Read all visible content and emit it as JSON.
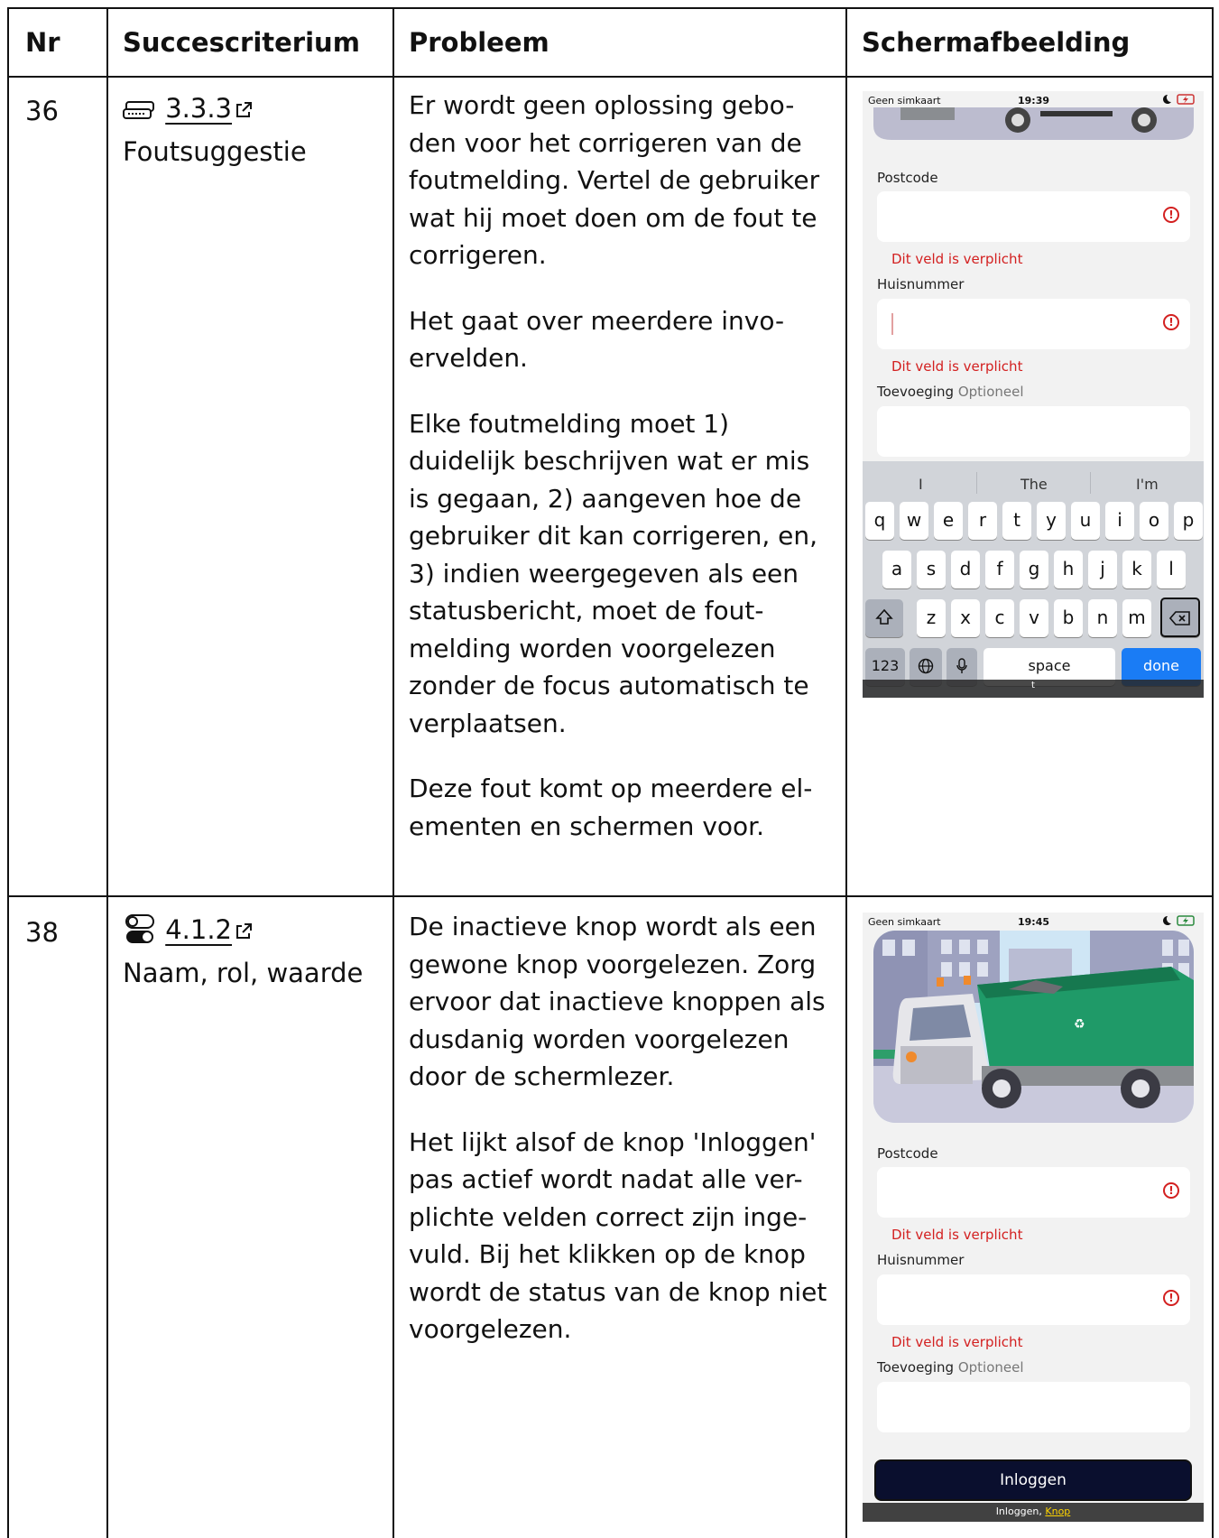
{
  "header": {
    "nr": "Nr",
    "criterion": "Succescriterium",
    "problem": "Probleem",
    "screenshot": "Schermafbeelding"
  },
  "rows": [
    {
      "nr": "36",
      "criterion_icon": "keyboard-form-icon",
      "criterion_code": "3.3.3",
      "criterion_name": "Foutsuggestie",
      "paragraphs": [
        "Er wordt geen oplossing gebo-\nden voor het corrigeren van de\nfoutmelding. Vertel de gebruiker\nwat hij moet doen om de fout te\ncorrigeren.",
        "Het gaat over meerdere invo-\nervelden.",
        "Elke foutmelding moet 1)\nduidelijk beschrijven wat er mis\nis gegaan, 2) aangeven hoe de\ngebruiker dit kan corrigeren, en,\n3) indien weergegeven als een\nstatusbericht, moet de fout-\nmelding worden voorgelezen\nzonder de focus automatisch te\nverplaatsen.",
        "Deze fout komt op meerdere el-\nementen en schermen voor."
      ],
      "screenshot": {
        "carrier": "Geen simkaart",
        "time": "19:39",
        "postcode_label": "Postcode",
        "postcode_error": "Dit veld is verplicht",
        "huisnummer_label": "Huisnummer",
        "huisnummer_error": "Dit veld is verplicht",
        "toevoeging_label": "Toevoeging",
        "toevoeging_optional": "Optioneel",
        "suggestions": [
          "I",
          "The",
          "I'm"
        ],
        "keys_row1": [
          "q",
          "w",
          "e",
          "r",
          "t",
          "y",
          "u",
          "i",
          "o",
          "p"
        ],
        "keys_row2": [
          "a",
          "s",
          "d",
          "f",
          "g",
          "h",
          "j",
          "k",
          "l"
        ],
        "keys_row3": [
          "z",
          "x",
          "c",
          "v",
          "b",
          "n",
          "m"
        ],
        "key_123": "123",
        "key_space": "space",
        "key_done": "done",
        "caption": "t"
      }
    },
    {
      "nr": "38",
      "criterion_icon": "toggle-switches-icon",
      "criterion_code": "4.1.2",
      "criterion_name": "Naam, rol, waarde",
      "paragraphs": [
        "De inactieve knop wordt als een\ngewone knop voorgelezen. Zorg\nervoor dat inactieve knoppen als\ndusdanig worden voorgelezen\ndoor de schermlezer.",
        "Het lijkt alsof de knop 'Inloggen'\npas actief wordt nadat alle ver-\nplichte velden correct zijn inge-\nvuld. Bij het klikken op de knop\nwordt de status van de knop niet\nvoorgelezen."
      ],
      "screenshot": {
        "carrier": "Geen simkaart",
        "time": "19:45",
        "postcode_label": "Postcode",
        "postcode_error": "Dit veld is verplicht",
        "huisnummer_label": "Huisnummer",
        "huisnummer_error": "Dit veld is verplicht",
        "toevoeging_label": "Toevoeging",
        "toevoeging_optional": "Optioneel",
        "login_button": "Inloggen",
        "caption_text": "Inloggen,",
        "caption_role": "Knop"
      }
    }
  ]
}
